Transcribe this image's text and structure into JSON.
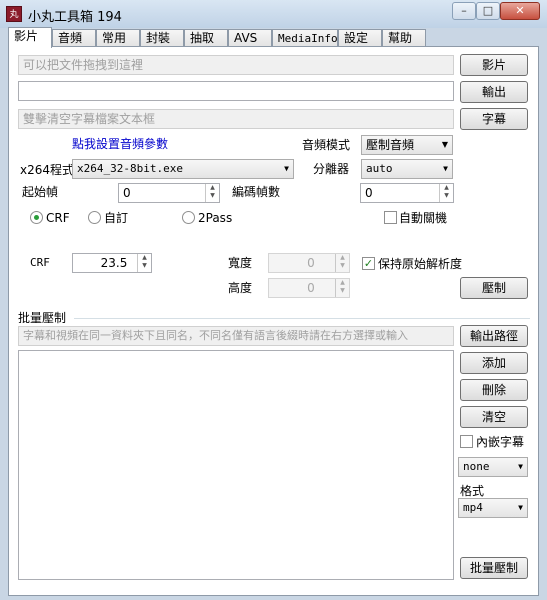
{
  "window": {
    "title": "小丸工具箱 194",
    "app_icon_text": "丸",
    "min": "–",
    "max": "□",
    "close": "✕"
  },
  "tabs": [
    "影片",
    "音頻",
    "常用",
    "封裝",
    "抽取",
    "AVS",
    "MediaInfo",
    "設定",
    "幫助"
  ],
  "video": {
    "drop_hint": "可以把文件拖拽到這裡",
    "output_value": "",
    "subtitle_hint": "雙擊清空字幕檔案文本框",
    "btn_video": "影片",
    "btn_output": "輸出",
    "btn_subtitle": "字幕",
    "audio_link": "點我設置音頻參數",
    "audio_mode_label": "音頻模式",
    "audio_mode_value": "壓制音頻",
    "x264_label": "x264程式",
    "x264_value": "x264_32-8bit.exe",
    "splitter_label": "分離器",
    "splitter_value": "auto",
    "start_frame_label": "起始幀",
    "start_frame_value": "0",
    "encode_frames_label": "編碼幀數",
    "encode_frames_value": "0",
    "radio_crf": "CRF",
    "radio_custom": "自訂",
    "radio_2pass": "2Pass",
    "auto_shutdown": "自動關機",
    "crf_label": "CRF",
    "crf_value": "23.5",
    "width_label": "寬度",
    "width_value": "0",
    "height_label": "高度",
    "height_value": "0",
    "keep_res": "保持原始解析度",
    "btn_encode": "壓制"
  },
  "batch": {
    "group_label": "批量壓制",
    "hint": "字幕和視頻在同一資料夾下且同名，不同名僅有語言後綴時請在右方選擇或輸入",
    "btn_output_path": "輸出路徑",
    "btn_add": "添加",
    "btn_delete": "刪除",
    "btn_clear": "清空",
    "embed_sub": "內嵌字幕",
    "lang_value": "none",
    "format_label": "格式",
    "format_value": "mp4",
    "btn_batch": "批量壓制"
  }
}
